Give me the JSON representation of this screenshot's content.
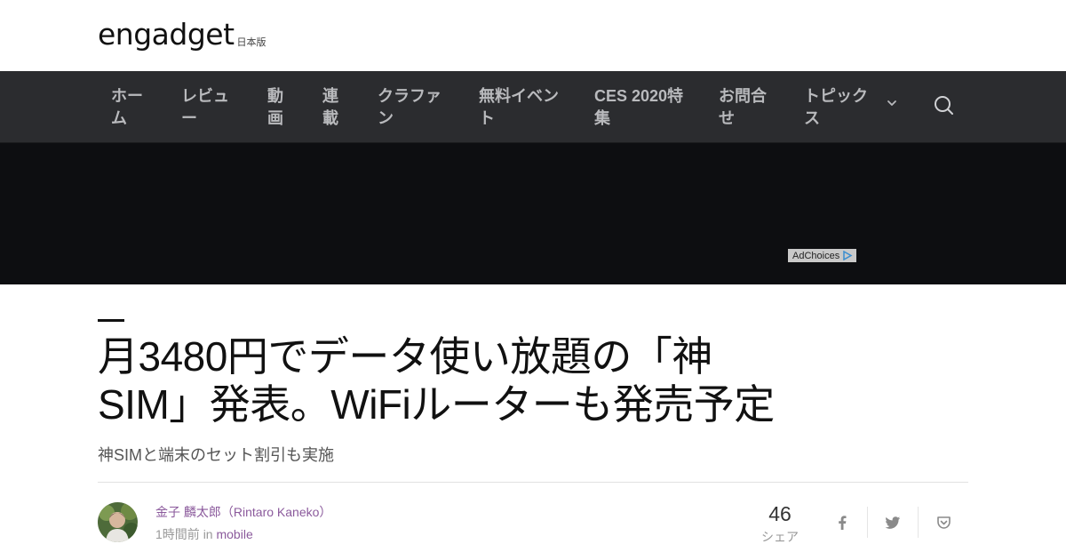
{
  "header": {
    "logo_text": "engadget",
    "logo_sub": "日本版"
  },
  "nav": {
    "items": [
      {
        "line1": "ホー",
        "line2": "ム"
      },
      {
        "line1": "レビュ",
        "line2": "ー"
      },
      {
        "line1": "動",
        "line2": "画"
      },
      {
        "line1": "連",
        "line2": "載"
      },
      {
        "line1": "クラファ",
        "line2": "ン"
      },
      {
        "line1": "無料イベン",
        "line2": "ト"
      },
      {
        "line1": "CES 2020特",
        "line2": "集"
      },
      {
        "line1": "お問合",
        "line2": "せ"
      },
      {
        "line1": "トピック",
        "line2": "ス"
      }
    ]
  },
  "ad": {
    "adchoices_label": "AdChoices"
  },
  "article": {
    "title_line1": "月3480円でデータ使い放題の「神",
    "title_line2": "SIM」発表。WiFiルーターも発売予定",
    "subtitle": "神SIMと端末のセット割引も実施",
    "author": "金子 麟太郎（Rintaro Kaneko）",
    "time": "1時間前",
    "in_word": "in",
    "category": "mobile"
  },
  "share": {
    "count": "46",
    "label": "シェア"
  },
  "icons": {
    "nav_more": "chevron-down-icon",
    "search": "search-icon",
    "facebook": "facebook-icon",
    "twitter": "twitter-icon",
    "pocket": "pocket-icon"
  },
  "colors": {
    "nav_bg": "#2b2c2f",
    "nav_text": "#b9babd",
    "ad_bg": "#0d0e11",
    "accent": "#8b5a9c"
  }
}
